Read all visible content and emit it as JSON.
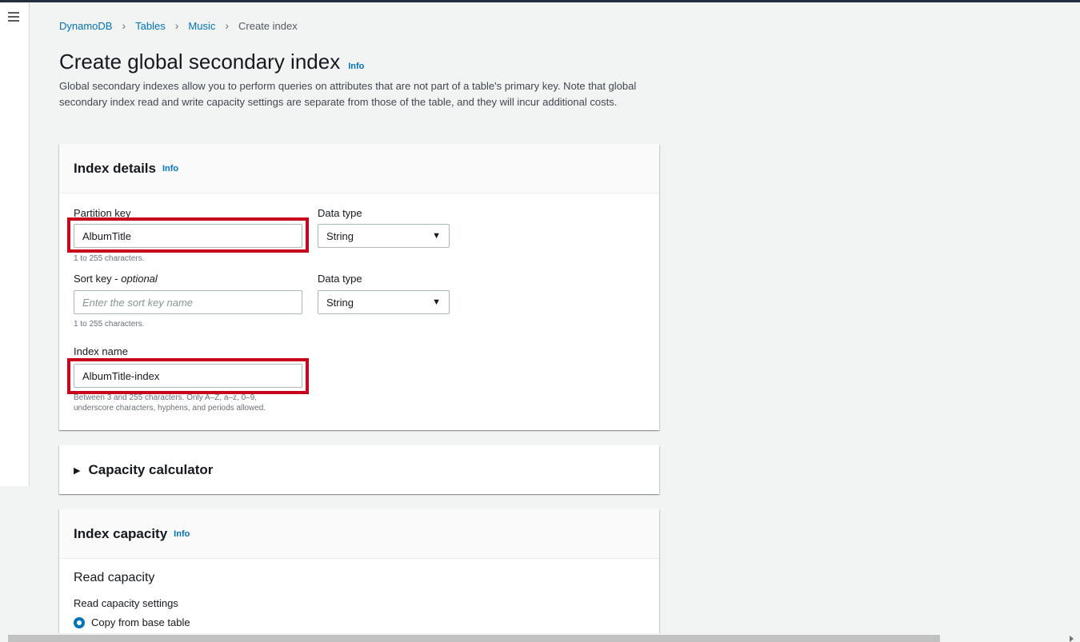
{
  "breadcrumb": {
    "item1": "DynamoDB",
    "item2": "Tables",
    "item3": "Music",
    "current": "Create index"
  },
  "page": {
    "title": "Create global secondary index",
    "info": "Info",
    "description": "Global secondary indexes allow you to perform queries on attributes that are not part of a table's primary key. Note that global secondary index read and write capacity settings are separate from those of the table, and they will incur additional costs."
  },
  "index_details": {
    "heading": "Index details",
    "info": "Info",
    "partition_key": {
      "label": "Partition key",
      "value": "AlbumTitle",
      "hint": "1 to 255 characters."
    },
    "partition_type": {
      "label": "Data type",
      "value": "String"
    },
    "sort_key": {
      "label_main": "Sort key - ",
      "label_optional": "optional",
      "placeholder": "Enter the sort key name",
      "value": "",
      "hint": "1 to 255 characters."
    },
    "sort_type": {
      "label": "Data type",
      "value": "String"
    },
    "index_name": {
      "label": "Index name",
      "value": "AlbumTitle-index",
      "hint_line1": "Between 3 and 255 characters. Only A–Z, a–z, 0–9,",
      "hint_line2": "underscore characters, hyphens, and periods allowed."
    }
  },
  "capacity_calculator": {
    "heading": "Capacity calculator"
  },
  "index_capacity": {
    "heading": "Index capacity",
    "info": "Info",
    "read_capacity": "Read capacity",
    "read_settings_label": "Read capacity settings",
    "option_copy": "Copy from base table"
  },
  "colors": {
    "highlight": "#c7001b",
    "link": "#0073bb"
  },
  "icons": {
    "menu": "hamburger-icon",
    "caret": "caret-down-icon",
    "expand": "triangle-right-icon"
  }
}
